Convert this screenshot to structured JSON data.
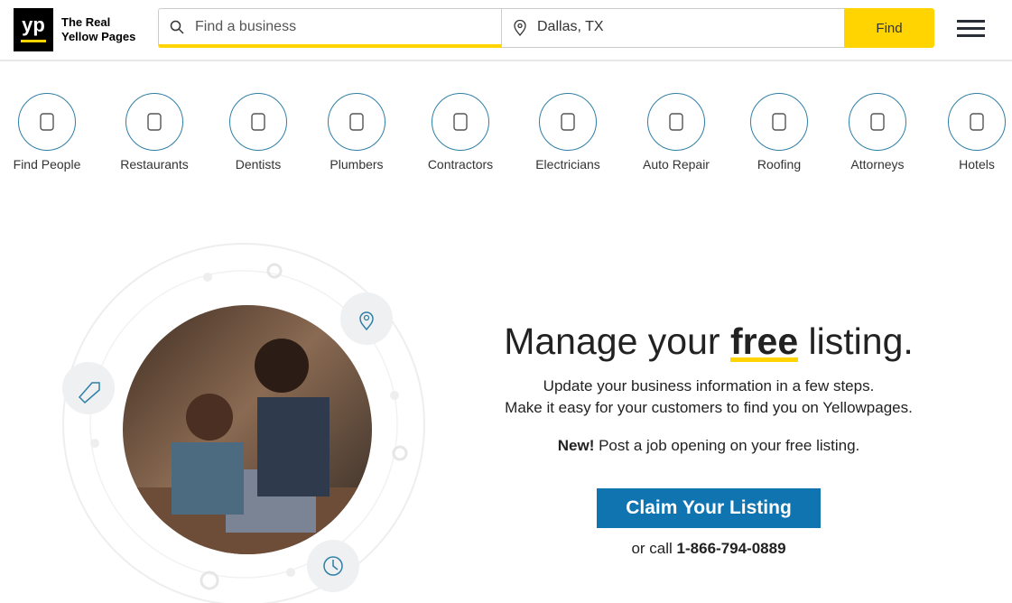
{
  "header": {
    "logo_text": "yp",
    "brand_line1": "The Real",
    "brand_line2": "Yellow Pages",
    "search_placeholder": "Find a business",
    "location_value": "Dallas, TX",
    "find_label": "Find"
  },
  "categories": [
    {
      "label": "Find People",
      "icon": "person-icon"
    },
    {
      "label": "Restaurants",
      "icon": "plate-icon"
    },
    {
      "label": "Dentists",
      "icon": "tooth-icon"
    },
    {
      "label": "Plumbers",
      "icon": "plunger-icon"
    },
    {
      "label": "Contractors",
      "icon": "worker-icon"
    },
    {
      "label": "Electricians",
      "icon": "plug-icon"
    },
    {
      "label": "Auto Repair",
      "icon": "car-wrench-icon"
    },
    {
      "label": "Roofing",
      "icon": "house-icon"
    },
    {
      "label": "Attorneys",
      "icon": "gavel-icon"
    },
    {
      "label": "Hotels",
      "icon": "hotel-icon"
    }
  ],
  "hero": {
    "title_pre": "Manage your ",
    "title_bold": "free",
    "title_post": " listing.",
    "line1": "Update your business information in a few steps.",
    "line2": "Make it easy for your customers to find you on Yellowpages.",
    "new_label": "New!",
    "new_text": " Post a job opening on your free listing.",
    "claim_label": "Claim Your Listing",
    "call_pre": "or call ",
    "phone": "1-866-794-0889"
  },
  "colors": {
    "accent": "#ffd400",
    "button": "#0f74b0",
    "circle": "#2f7fa6"
  }
}
